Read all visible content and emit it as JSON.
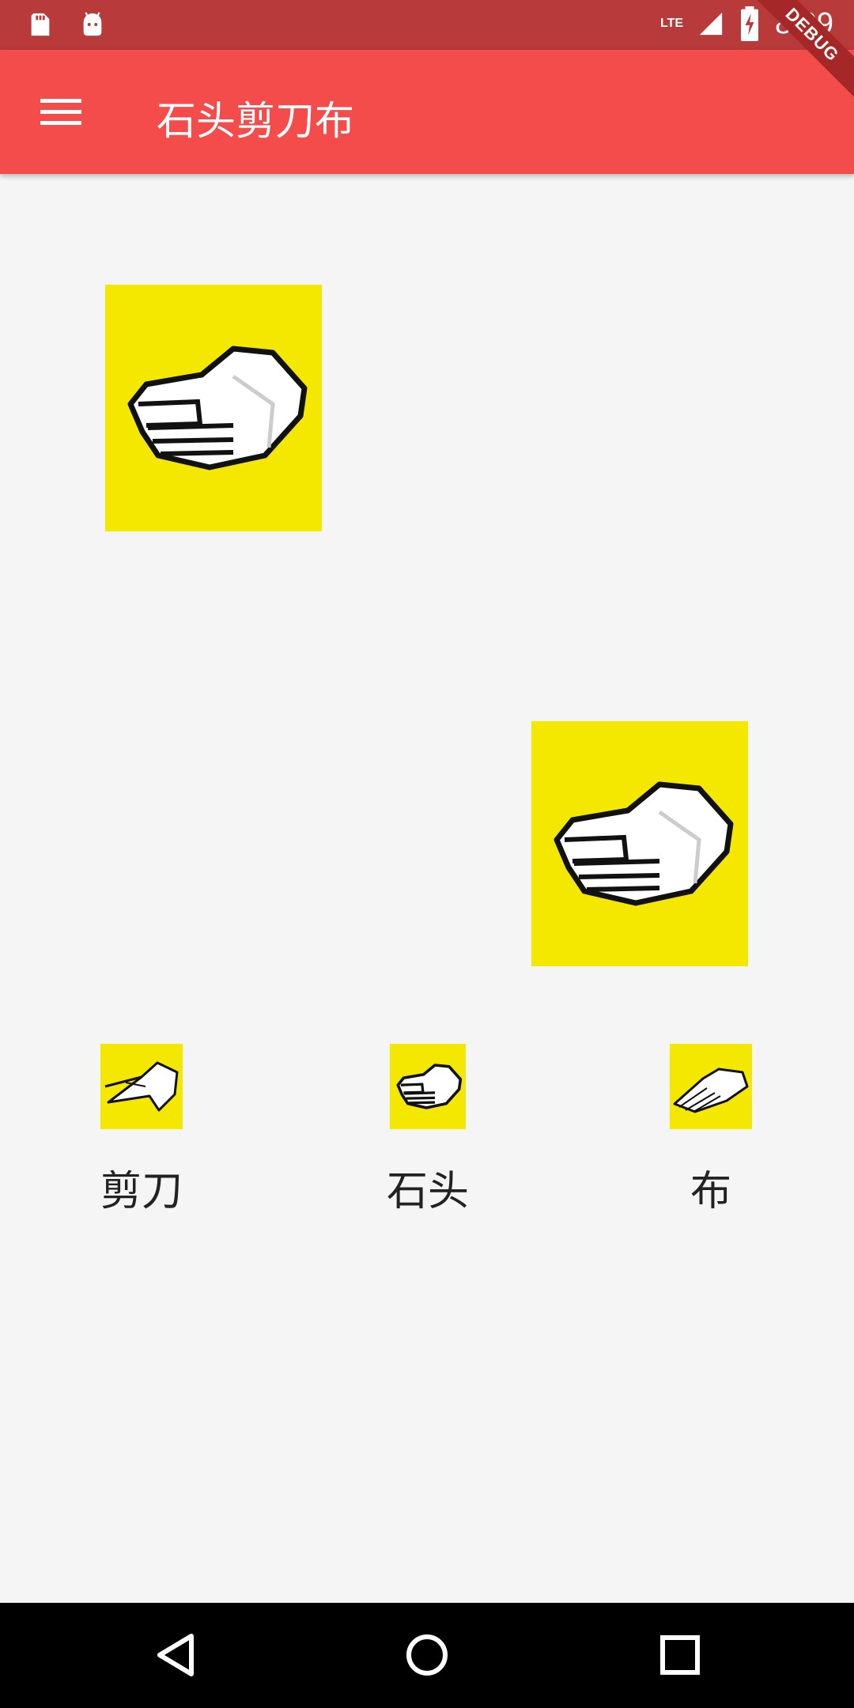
{
  "status_bar": {
    "time": "8:09",
    "network": "LTE",
    "icons": [
      "sd-card-icon",
      "android-icon",
      "signal-icon",
      "battery-icon"
    ]
  },
  "debug_banner": "DEBUG",
  "app_bar": {
    "title": "石头剪刀布",
    "menu_icon": "menu-icon",
    "background": "#f44b4b"
  },
  "game": {
    "player_hand": "rock",
    "computer_hand": "rock",
    "card_color": "#f4e800"
  },
  "choices": [
    {
      "id": "scissors",
      "label": "剪刀",
      "icon": "scissors-hand-icon"
    },
    {
      "id": "rock",
      "label": "石头",
      "icon": "rock-hand-icon"
    },
    {
      "id": "paper",
      "label": "布",
      "icon": "paper-hand-icon"
    }
  ],
  "nav_bar": {
    "back": "back-icon",
    "home": "home-icon",
    "recent": "recents-icon"
  }
}
